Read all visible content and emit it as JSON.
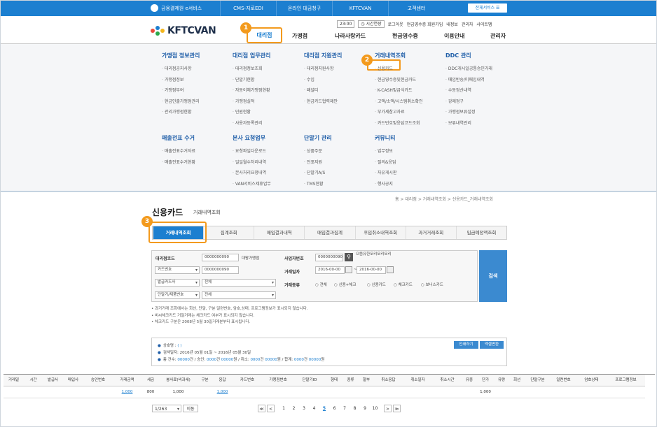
{
  "topbar": {
    "service_title": "금융결제원 e서비스",
    "links": [
      "CMS-지로EDI",
      "온라인 대금청구",
      "KFTCVAN",
      "고객센터"
    ],
    "all_services_label": "전체서비스 ☰"
  },
  "header": {
    "brand": "KFTCVAN",
    "utility": {
      "time_box": "23:00",
      "extend_label": "시간연장",
      "links": [
        "로그아웃",
        "현금영수증 회원가입",
        "내정보",
        "관리자",
        "사이트맵"
      ]
    },
    "nav": [
      "대리점",
      "가맹점",
      "나라사랑카드",
      "현금영수증",
      "이용안내",
      "관리자"
    ]
  },
  "badges": [
    "1",
    "2",
    "3"
  ],
  "mega_menu": {
    "columns": [
      {
        "title": "가맹점 정보관리",
        "items": [
          "대리점공지사항",
          "가맹점정보",
          "가맹점부여",
          "현금인출가맹점관리",
          "관리가맹점현황"
        ]
      },
      {
        "title": "대리점 업무관리",
        "items": [
          "대리점정보조회",
          "단말기현황",
          "자동이체가맹점현황",
          "가맹점실적",
          "민원현황",
          "사용자등록관리"
        ]
      },
      {
        "title": "대리점 지원관리",
        "items": [
          "대리점지원사항",
          "수입",
          "패널티",
          "현금카드협력제안"
        ]
      },
      {
        "title": "거래내역조회",
        "items": [
          "신용카드",
          "현금영수증및현금카드",
          "K-CASH및급식카드",
          "고액/소액/시스템취소확인",
          "부가세참고자료",
          "카드번호및응답코드조회"
        ]
      },
      {
        "title": "DDC 관리",
        "items": [
          "DDC개시일공통승인거래",
          "매입반송/미매입내역",
          "수동정산내역",
          "강제정구",
          "가맹점보류설정",
          "보류내역관리"
        ]
      },
      {
        "title": "매출전표 수거",
        "items": [
          "매출전표수거자료",
          "매출전표수거현황"
        ]
      },
      {
        "title": "본사 요청업무",
        "items": [
          "요청파일다운로드",
          "일일월수처리내역",
          "본사처리요청내역",
          "VAN서비스제휴업무"
        ]
      },
      {
        "title": "단말기 관리",
        "items": [
          "상품주문",
          "전표지원",
          "단말기A/S",
          "TMS현황"
        ]
      },
      {
        "title": "커뮤니티",
        "items": [
          "업무정보",
          "질의&응답",
          "자유게시판",
          "행사공지"
        ]
      }
    ]
  },
  "breadcrumb": "홈 > 대리점 > 거래내역조회 > 신용카드_거래내역조회",
  "page": {
    "title": "신용카드",
    "subtitle": "거래내역조회"
  },
  "tabs": [
    "거래내역조회",
    "집계조회",
    "매입결과내역",
    "매입결과집계",
    "후입취소내역조회",
    "과거거래조회",
    "입금예정액조회"
  ],
  "search": {
    "agency_code_label": "대리점코드",
    "agency_code_value": "0000000090",
    "agency_name": "대왕가맹점",
    "card_no_select": "카드번호",
    "card_no_value": "0000000090",
    "issuer_select": "발급카드사",
    "issuer_value": "전체",
    "terminal_select": "단말기/제품번호",
    "terminal_value": "전체",
    "bizno_label": "사업자번호",
    "bizno_value": "0000000090",
    "bizno_name": "으뜸유한모리모리모리",
    "date_label": "거래일자",
    "date_from": "2016-00-00",
    "date_to": "2016-00-00",
    "type_label": "거래종류",
    "type_options": [
      "전체",
      "신용+체크",
      "신용카드",
      "체크카드",
      "보너스카드"
    ],
    "search_button": "검색"
  },
  "notes": [
    "과거거래 조회에서는 회선, 단말, 구분 일련번호, 암호,상태, 프로그램정보가 표시되지 않습니다.",
    "비씨체크카드 거절거래는 체크카드 여부가 표시되지 않습니다.",
    "체크카드 구분은 2008년 5월 30일거래분부터 표시됩니다."
  ],
  "summary": {
    "merchant_label": "상호명 : ",
    "merchant_value": "( )",
    "period": "검색일자: 2016년 05월 01일 ~ 2016년 05월 30일",
    "counts": {
      "prefix": "총 건수: ",
      "total": "00000",
      "t1": "건 / 승인: ",
      "approve": "0000",
      "t2": "건 ",
      "approve_amt": "00000",
      "t3": "원 / 취소: ",
      "cancel": "0000",
      "t4": "건 ",
      "cancel_amt": "00000",
      "t5": "원 / 합계: ",
      "sum": "0000",
      "t6": "건 ",
      "sum_amt": "00000",
      "t7": "원"
    },
    "print_button": "인쇄하기",
    "excel_button": "엑셀변환"
  },
  "table": {
    "headers": [
      "거래일",
      "시간",
      "발급사",
      "매입사",
      "승인번호",
      "거래금액",
      "세금",
      "봉사료(비과세)",
      "구분",
      "응답",
      "카드번호",
      "가맹점번호",
      "단말기ID",
      "형태",
      "종류",
      "할부",
      "취소응답",
      "취소일자",
      "취소시간",
      "유종",
      "단가",
      "유량",
      "회선",
      "단말구분",
      "일련번호",
      "암호상태",
      "프로그램정보"
    ],
    "rows": [
      [
        "",
        "",
        "",
        "",
        "",
        "1,000",
        "800",
        "1,000",
        "",
        "1,000",
        "",
        "",
        "",
        "",
        "",
        "",
        "",
        "",
        "",
        "",
        "1,000",
        "",
        "",
        "",
        "",
        "",
        ""
      ]
    ]
  },
  "pager": {
    "page_select": "1/263",
    "go_button": "이동",
    "first": "≪",
    "prev": "<",
    "pages": [
      "1",
      "2",
      "3",
      "4",
      "5",
      "6",
      "7",
      "8",
      "9",
      "10"
    ],
    "current": "5",
    "next": ">",
    "last": "≫"
  },
  "colors": {
    "primary": "#1c7fd0",
    "highlight": "#f39a1d",
    "menu_bg": "#f5f6f8"
  }
}
